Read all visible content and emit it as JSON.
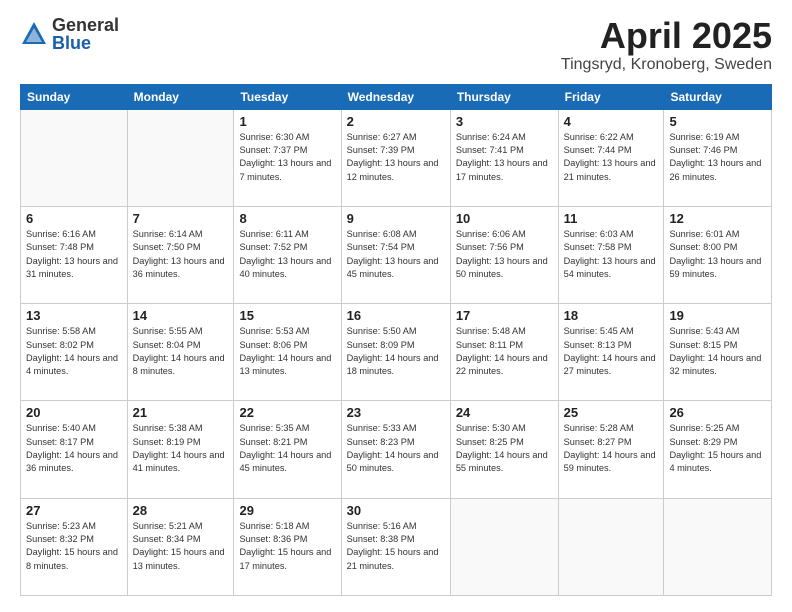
{
  "header": {
    "logo_general": "General",
    "logo_blue": "Blue",
    "month_title": "April 2025",
    "location": "Tingsryd, Kronoberg, Sweden"
  },
  "weekdays": [
    "Sunday",
    "Monday",
    "Tuesday",
    "Wednesday",
    "Thursday",
    "Friday",
    "Saturday"
  ],
  "weeks": [
    [
      {
        "day": "",
        "info": ""
      },
      {
        "day": "",
        "info": ""
      },
      {
        "day": "1",
        "info": "Sunrise: 6:30 AM\nSunset: 7:37 PM\nDaylight: 13 hours and 7 minutes."
      },
      {
        "day": "2",
        "info": "Sunrise: 6:27 AM\nSunset: 7:39 PM\nDaylight: 13 hours and 12 minutes."
      },
      {
        "day": "3",
        "info": "Sunrise: 6:24 AM\nSunset: 7:41 PM\nDaylight: 13 hours and 17 minutes."
      },
      {
        "day": "4",
        "info": "Sunrise: 6:22 AM\nSunset: 7:44 PM\nDaylight: 13 hours and 21 minutes."
      },
      {
        "day": "5",
        "info": "Sunrise: 6:19 AM\nSunset: 7:46 PM\nDaylight: 13 hours and 26 minutes."
      }
    ],
    [
      {
        "day": "6",
        "info": "Sunrise: 6:16 AM\nSunset: 7:48 PM\nDaylight: 13 hours and 31 minutes."
      },
      {
        "day": "7",
        "info": "Sunrise: 6:14 AM\nSunset: 7:50 PM\nDaylight: 13 hours and 36 minutes."
      },
      {
        "day": "8",
        "info": "Sunrise: 6:11 AM\nSunset: 7:52 PM\nDaylight: 13 hours and 40 minutes."
      },
      {
        "day": "9",
        "info": "Sunrise: 6:08 AM\nSunset: 7:54 PM\nDaylight: 13 hours and 45 minutes."
      },
      {
        "day": "10",
        "info": "Sunrise: 6:06 AM\nSunset: 7:56 PM\nDaylight: 13 hours and 50 minutes."
      },
      {
        "day": "11",
        "info": "Sunrise: 6:03 AM\nSunset: 7:58 PM\nDaylight: 13 hours and 54 minutes."
      },
      {
        "day": "12",
        "info": "Sunrise: 6:01 AM\nSunset: 8:00 PM\nDaylight: 13 hours and 59 minutes."
      }
    ],
    [
      {
        "day": "13",
        "info": "Sunrise: 5:58 AM\nSunset: 8:02 PM\nDaylight: 14 hours and 4 minutes."
      },
      {
        "day": "14",
        "info": "Sunrise: 5:55 AM\nSunset: 8:04 PM\nDaylight: 14 hours and 8 minutes."
      },
      {
        "day": "15",
        "info": "Sunrise: 5:53 AM\nSunset: 8:06 PM\nDaylight: 14 hours and 13 minutes."
      },
      {
        "day": "16",
        "info": "Sunrise: 5:50 AM\nSunset: 8:09 PM\nDaylight: 14 hours and 18 minutes."
      },
      {
        "day": "17",
        "info": "Sunrise: 5:48 AM\nSunset: 8:11 PM\nDaylight: 14 hours and 22 minutes."
      },
      {
        "day": "18",
        "info": "Sunrise: 5:45 AM\nSunset: 8:13 PM\nDaylight: 14 hours and 27 minutes."
      },
      {
        "day": "19",
        "info": "Sunrise: 5:43 AM\nSunset: 8:15 PM\nDaylight: 14 hours and 32 minutes."
      }
    ],
    [
      {
        "day": "20",
        "info": "Sunrise: 5:40 AM\nSunset: 8:17 PM\nDaylight: 14 hours and 36 minutes."
      },
      {
        "day": "21",
        "info": "Sunrise: 5:38 AM\nSunset: 8:19 PM\nDaylight: 14 hours and 41 minutes."
      },
      {
        "day": "22",
        "info": "Sunrise: 5:35 AM\nSunset: 8:21 PM\nDaylight: 14 hours and 45 minutes."
      },
      {
        "day": "23",
        "info": "Sunrise: 5:33 AM\nSunset: 8:23 PM\nDaylight: 14 hours and 50 minutes."
      },
      {
        "day": "24",
        "info": "Sunrise: 5:30 AM\nSunset: 8:25 PM\nDaylight: 14 hours and 55 minutes."
      },
      {
        "day": "25",
        "info": "Sunrise: 5:28 AM\nSunset: 8:27 PM\nDaylight: 14 hours and 59 minutes."
      },
      {
        "day": "26",
        "info": "Sunrise: 5:25 AM\nSunset: 8:29 PM\nDaylight: 15 hours and 4 minutes."
      }
    ],
    [
      {
        "day": "27",
        "info": "Sunrise: 5:23 AM\nSunset: 8:32 PM\nDaylight: 15 hours and 8 minutes."
      },
      {
        "day": "28",
        "info": "Sunrise: 5:21 AM\nSunset: 8:34 PM\nDaylight: 15 hours and 13 minutes."
      },
      {
        "day": "29",
        "info": "Sunrise: 5:18 AM\nSunset: 8:36 PM\nDaylight: 15 hours and 17 minutes."
      },
      {
        "day": "30",
        "info": "Sunrise: 5:16 AM\nSunset: 8:38 PM\nDaylight: 15 hours and 21 minutes."
      },
      {
        "day": "",
        "info": ""
      },
      {
        "day": "",
        "info": ""
      },
      {
        "day": "",
        "info": ""
      }
    ]
  ]
}
